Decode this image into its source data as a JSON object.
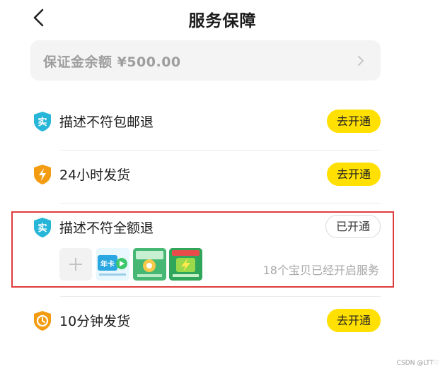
{
  "header": {
    "title": "服务保障",
    "back_icon": "chevron-left-icon"
  },
  "deposit": {
    "label": "保证金余额 ¥500.00",
    "arrow_icon": "chevron-right-icon"
  },
  "services": [
    {
      "label": "描述不符包邮退",
      "badge": "实",
      "badge_color": "#27b5d8",
      "action": "去开通"
    },
    {
      "label": "24小时发货",
      "badge": "lightning",
      "badge_color": "#f39c12",
      "action": "去开通"
    },
    {
      "label": "描述不符全额退",
      "badge": "实",
      "badge_color": "#27b5d8",
      "action": "已开通",
      "products": {
        "thumbnails": [
          {
            "text": "年卡",
            "icon": "video-card-icon"
          },
          {
            "text": "",
            "icon": "green-promo-icon"
          },
          {
            "text": "",
            "icon": "lightning-promo-icon"
          }
        ],
        "summary": "18个宝贝已经开启服务"
      }
    },
    {
      "label": "10分钟发货",
      "badge": "clock",
      "badge_color": "#f39c12",
      "action": "去开通"
    }
  ],
  "colors": {
    "accent_button": "#ffe000",
    "highlight_border": "#e03b3b"
  },
  "watermark": "CSDN @LTT♡"
}
